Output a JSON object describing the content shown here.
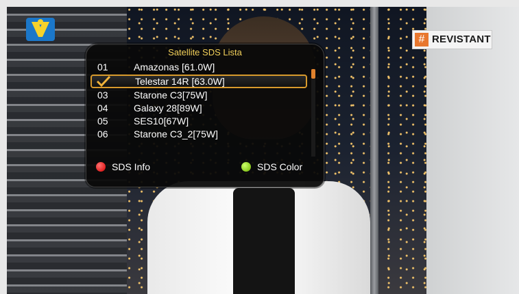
{
  "background": {
    "scene": "tv-studio-broadcast"
  },
  "overlay": {
    "brand_text": "REVISTANT",
    "brand_mark": "#",
    "brand_color": "#e8772e"
  },
  "dialog": {
    "title": "Satellite SDS Lista",
    "title_color": "#f2d05a",
    "selected_index": 1,
    "items": [
      {
        "num": "01",
        "name": "Amazonas [61.0W]"
      },
      {
        "num": "",
        "name": "Telestar 14R [63.0W]",
        "icon": "check-icon"
      },
      {
        "num": "03",
        "name": "Starone C3[75W]"
      },
      {
        "num": "04",
        "name": "Galaxy 28[89W]"
      },
      {
        "num": "05",
        "name": "SES10[67W]"
      },
      {
        "num": "06",
        "name": "Starone C3_2[75W]"
      }
    ],
    "footer": {
      "red_label": "SDS Info",
      "green_label": "SDS Color"
    },
    "accent_color": "#d89a2c"
  }
}
